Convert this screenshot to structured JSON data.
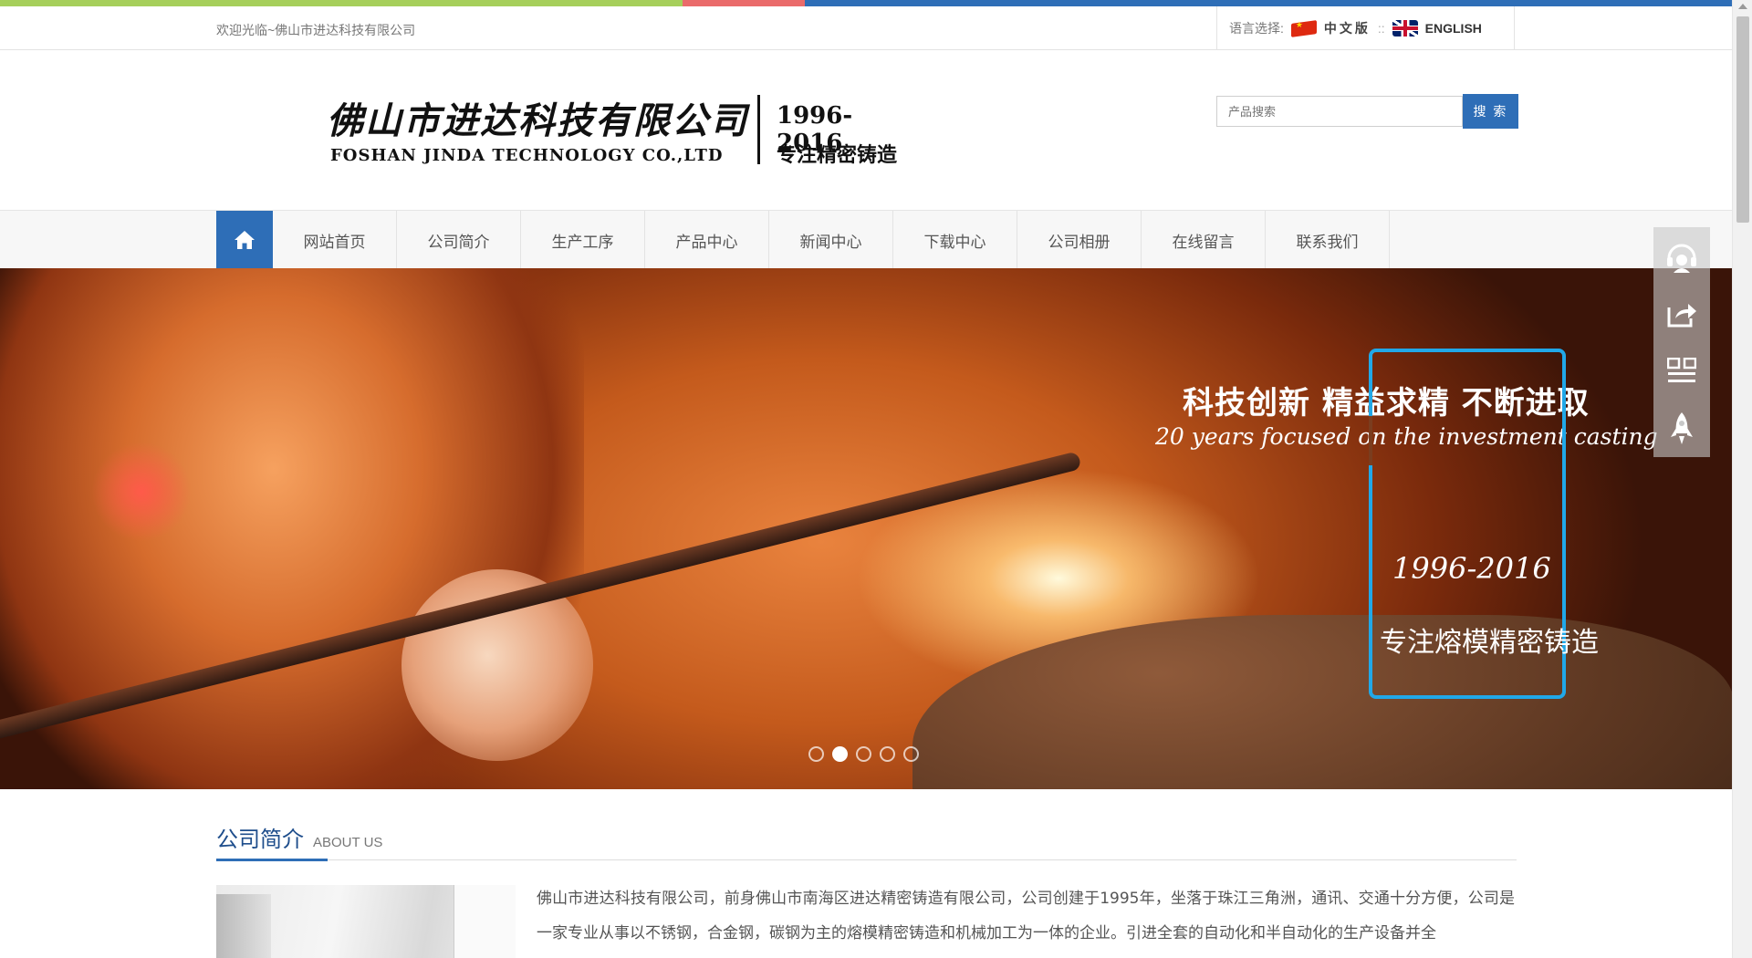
{
  "topbar": {
    "colors": [
      "#a6cf5b",
      "#ea6b6b",
      "#2e6eb7"
    ]
  },
  "header": {
    "welcome": "欢迎光临~佛山市进达科技有限公司",
    "lang_label": "语言选择:",
    "lang_cn": "中文版",
    "lang_sep": "::",
    "lang_en": "ENGLISH"
  },
  "logo": {
    "cn_name": "佛山市进达科技有限公司",
    "en_name": "FOSHAN JINDA TECHNOLOGY CO.,LTD",
    "years": "1996-2016",
    "slogan": "专注精密铸造"
  },
  "search": {
    "placeholder": "产品搜索",
    "button": "搜 索"
  },
  "nav": {
    "home_icon": "home-icon",
    "items": [
      "网站首页",
      "公司简介",
      "生产工序",
      "产品中心",
      "新闻中心",
      "下载中心",
      "公司相册",
      "在线留言",
      "联系我们"
    ]
  },
  "banner": {
    "slogan_cn": "科技创新 精益求精 不断进取",
    "slogan_en": "20 years focused on the investment casting",
    "years": "1996-2016",
    "slogan_box": "专注熔模精密铸造",
    "slide_count": 5,
    "active_slide": 2
  },
  "sidebar": {
    "icons": [
      "headset-icon",
      "share-icon",
      "qrcode-icon",
      "rocket-icon"
    ]
  },
  "about": {
    "title": "公司简介",
    "subtitle": "ABOUT US",
    "text": "佛山市进达科技有限公司，前身佛山市南海区进达精密铸造有限公司，公司创建于1995年，坐落于珠江三角洲，通讯、交通十分方便，公司是一家专业从事以不锈钢，合金钢，碳钢为主的熔模精密铸造和机械加工为一体的企业。引进全套的自动化和半自动化的生产设备并全"
  },
  "colors": {
    "accent": "#2e6eb7",
    "banner_box": "#21a8e8"
  }
}
